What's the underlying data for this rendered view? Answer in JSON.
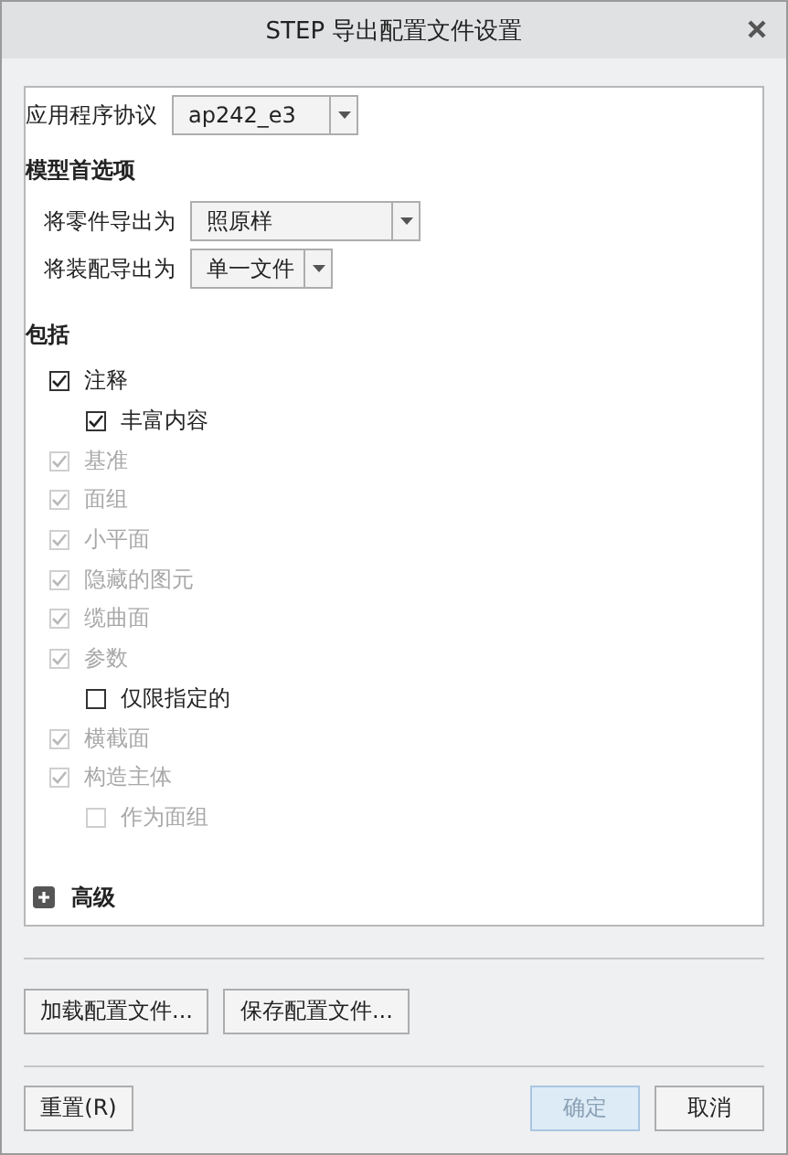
{
  "window": {
    "title": "STEP 导出配置文件设置"
  },
  "protocol": {
    "label": "应用程序协议",
    "value": "ap242_e3"
  },
  "model_prefs": {
    "heading": "模型首选项",
    "fields": [
      {
        "label": "将零件导出为",
        "value": "照原样"
      },
      {
        "label": "将装配导出为",
        "value": "单一文件"
      }
    ]
  },
  "include": {
    "heading": "包括",
    "items": [
      {
        "label": "注释",
        "checked": true,
        "disabled": false,
        "children": [
          {
            "label": "丰富内容",
            "checked": true,
            "disabled": false
          }
        ]
      },
      {
        "label": "基准",
        "checked": true,
        "disabled": true
      },
      {
        "label": "面组",
        "checked": true,
        "disabled": true
      },
      {
        "label": "小平面",
        "checked": true,
        "disabled": true
      },
      {
        "label": "隐藏的图元",
        "checked": true,
        "disabled": true
      },
      {
        "label": "缆曲面",
        "checked": true,
        "disabled": true
      },
      {
        "label": "参数",
        "checked": true,
        "disabled": true,
        "children": [
          {
            "label": "仅限指定的",
            "checked": false,
            "disabled": false
          }
        ]
      },
      {
        "label": "横截面",
        "checked": true,
        "disabled": true
      },
      {
        "label": "构造主体",
        "checked": true,
        "disabled": true,
        "children": [
          {
            "label": "作为面组",
            "checked": false,
            "disabled": true
          }
        ]
      }
    ]
  },
  "advanced": {
    "label": "高级",
    "expanded": false
  },
  "profile_buttons": [
    "加载配置文件...",
    "保存配置文件..."
  ],
  "footer": {
    "buttons": [
      {
        "label": "重置(R)",
        "kind": "plain"
      },
      {
        "label": "确定",
        "kind": "default"
      },
      {
        "label": "取消",
        "kind": "plain"
      }
    ]
  }
}
